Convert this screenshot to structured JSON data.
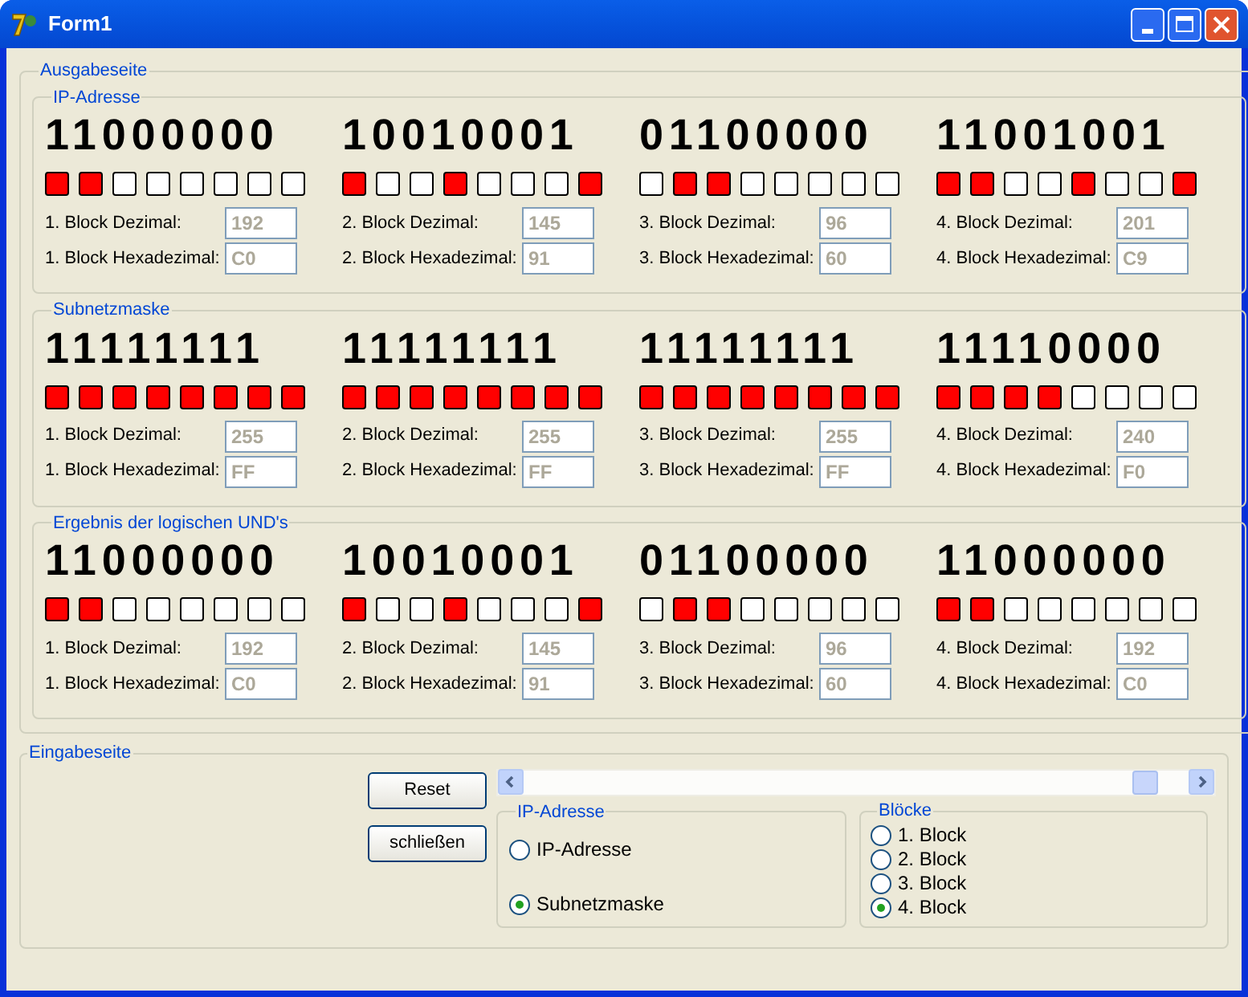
{
  "window": {
    "title": "Form1"
  },
  "output": {
    "title": "Ausgabeseite",
    "groups": [
      {
        "title": "IP-Adresse",
        "blocks": [
          {
            "binary": "11000000",
            "bits": [
              true,
              true,
              false,
              false,
              false,
              false,
              false,
              false
            ],
            "dec_label": "1. Block Dezimal:",
            "dec": "192",
            "hex_label": "1. Block Hexadezimal:",
            "hex": "C0"
          },
          {
            "binary": "10010001",
            "bits": [
              true,
              false,
              false,
              true,
              false,
              false,
              false,
              true
            ],
            "dec_label": "2. Block Dezimal:",
            "dec": "145",
            "hex_label": "2. Block Hexadezimal:",
            "hex": "91"
          },
          {
            "binary": "01100000",
            "bits": [
              false,
              true,
              true,
              false,
              false,
              false,
              false,
              false
            ],
            "dec_label": "3. Block Dezimal:",
            "dec": "96",
            "hex_label": "3. Block Hexadezimal:",
            "hex": "60"
          },
          {
            "binary": "11001001",
            "bits": [
              true,
              true,
              false,
              false,
              true,
              false,
              false,
              true
            ],
            "dec_label": "4. Block Dezimal:",
            "dec": "201",
            "hex_label": "4. Block Hexadezimal:",
            "hex": "C9"
          }
        ]
      },
      {
        "title": "Subnetzmaske",
        "blocks": [
          {
            "binary": "11111111",
            "bits": [
              true,
              true,
              true,
              true,
              true,
              true,
              true,
              true
            ],
            "dec_label": "1. Block Dezimal:",
            "dec": "255",
            "hex_label": "1. Block Hexadezimal:",
            "hex": "FF"
          },
          {
            "binary": "11111111",
            "bits": [
              true,
              true,
              true,
              true,
              true,
              true,
              true,
              true
            ],
            "dec_label": "2. Block Dezimal:",
            "dec": "255",
            "hex_label": "2. Block Hexadezimal:",
            "hex": "FF"
          },
          {
            "binary": "11111111",
            "bits": [
              true,
              true,
              true,
              true,
              true,
              true,
              true,
              true
            ],
            "dec_label": "3. Block Dezimal:",
            "dec": "255",
            "hex_label": "3. Block Hexadezimal:",
            "hex": "FF"
          },
          {
            "binary": "11110000",
            "bits": [
              true,
              true,
              true,
              true,
              false,
              false,
              false,
              false
            ],
            "dec_label": "4. Block Dezimal:",
            "dec": "240",
            "hex_label": "4. Block Hexadezimal:",
            "hex": "F0"
          }
        ]
      },
      {
        "title": "Ergebnis der logischen UND's",
        "blocks": [
          {
            "binary": "11000000",
            "bits": [
              true,
              true,
              false,
              false,
              false,
              false,
              false,
              false
            ],
            "dec_label": "1. Block Dezimal:",
            "dec": "192",
            "hex_label": "1. Block Hexadezimal:",
            "hex": "C0"
          },
          {
            "binary": "10010001",
            "bits": [
              true,
              false,
              false,
              true,
              false,
              false,
              false,
              true
            ],
            "dec_label": "2. Block Dezimal:",
            "dec": "145",
            "hex_label": "2. Block Hexadezimal:",
            "hex": "91"
          },
          {
            "binary": "01100000",
            "bits": [
              false,
              true,
              true,
              false,
              false,
              false,
              false,
              false
            ],
            "dec_label": "3. Block Dezimal:",
            "dec": "96",
            "hex_label": "3. Block Hexadezimal:",
            "hex": "60"
          },
          {
            "binary": "11000000",
            "bits": [
              true,
              true,
              false,
              false,
              false,
              false,
              false,
              false
            ],
            "dec_label": "4. Block Dezimal:",
            "dec": "192",
            "hex_label": "4. Block Hexadezimal:",
            "hex": "C0"
          }
        ]
      }
    ]
  },
  "input": {
    "title": "Eingabeseite",
    "buttons": [
      "Reset",
      "schließen"
    ],
    "address_group": {
      "title": "IP-Adresse",
      "options": [
        {
          "label": "IP-Adresse",
          "selected": false
        },
        {
          "label": "Subnetzmaske",
          "selected": true
        }
      ]
    },
    "block_group": {
      "title": "Blöcke",
      "options": [
        {
          "label": "1. Block",
          "selected": false
        },
        {
          "label": "2. Block",
          "selected": false
        },
        {
          "label": "3. Block",
          "selected": false
        },
        {
          "label": "4. Block",
          "selected": true
        }
      ]
    }
  }
}
